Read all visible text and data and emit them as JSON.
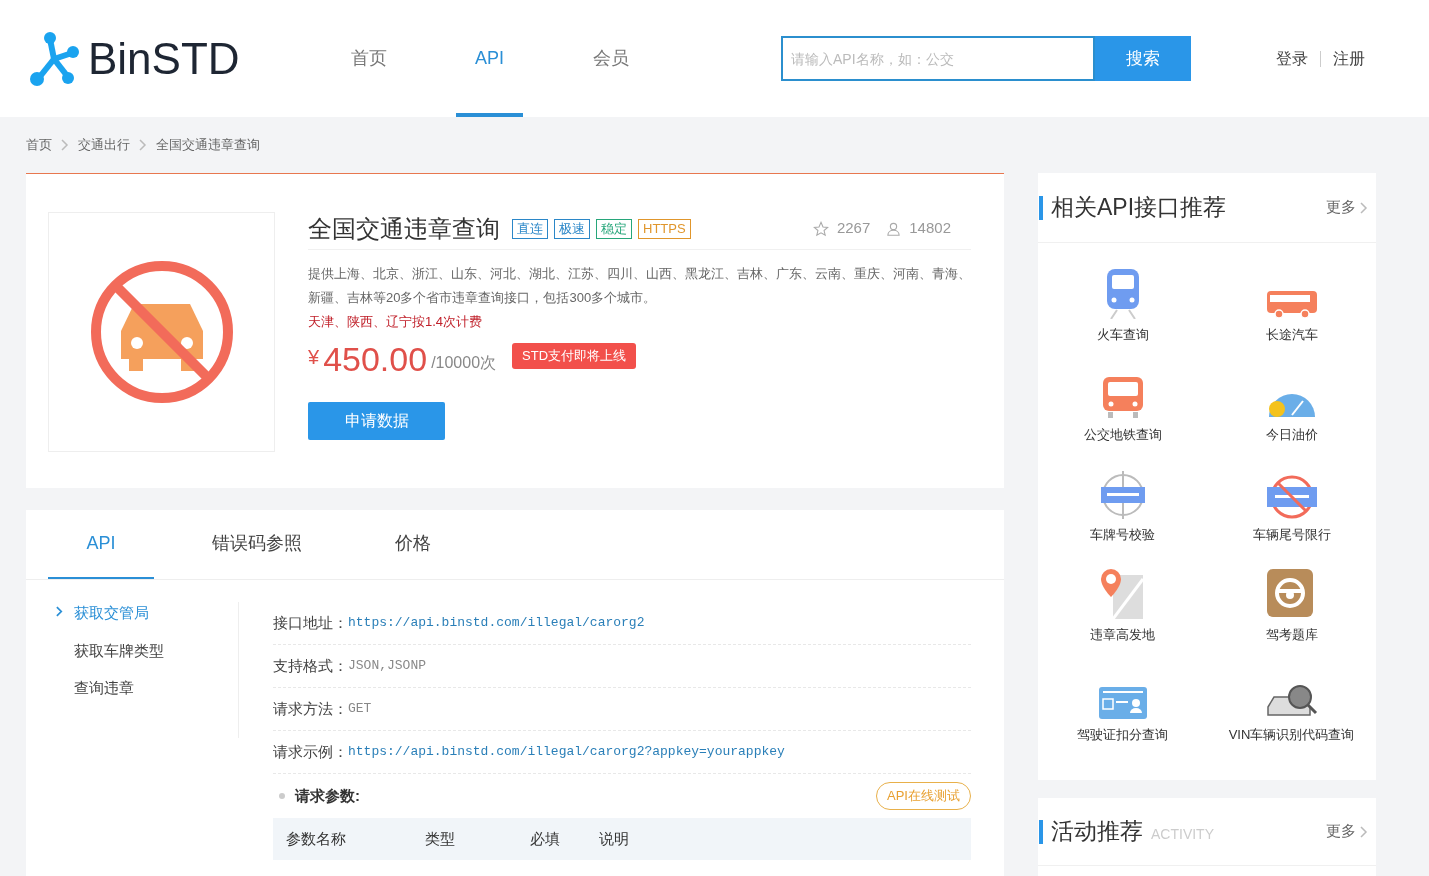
{
  "header": {
    "logo": "BinSTD",
    "nav": [
      {
        "label": "首页",
        "selected": false
      },
      {
        "label": "API",
        "selected": true
      },
      {
        "label": "会员",
        "selected": false
      }
    ],
    "search": {
      "placeholder": "请输入API名称，如：公交",
      "button": "搜索"
    },
    "auth": [
      "登录",
      "注册"
    ]
  },
  "breadcrumb": [
    "首页",
    "交通出行",
    "全国交通违章查询"
  ],
  "product": {
    "title": "全国交通违章查询",
    "tags": [
      {
        "label": "直连",
        "color": "#2b87c8"
      },
      {
        "label": "极速",
        "color": "#2b87c8"
      },
      {
        "label": "稳定",
        "color": "#27a67a"
      },
      {
        "label": "HTTPS",
        "color": "#e0962c"
      }
    ],
    "favorites": "2267",
    "users": "14802",
    "description": "提供上海、北京、浙江、山东、河北、湖北、江苏、四川、山西、黑龙江、吉林、广东、云南、重庆、河南、青海、新疆、吉林等20多个省市违章查询接口，包括300多个城市。",
    "note": "天津、陕西、辽宁按1.4次计费",
    "currency": "¥",
    "price": "450.00",
    "unit": "/10000次",
    "promo": "STD支付即将上线",
    "apply": "申请数据"
  },
  "tabs": [
    {
      "label": "API",
      "selected": true
    },
    {
      "label": "错误码参照",
      "selected": false
    },
    {
      "label": "价格",
      "selected": false
    }
  ],
  "methods": [
    {
      "label": "获取交管局",
      "selected": true
    },
    {
      "label": "获取车牌类型",
      "selected": false
    },
    {
      "label": "查询违章",
      "selected": false
    }
  ],
  "details": [
    {
      "label": "接口地址：",
      "value": "https://api.binstd.com/illegal/carorg2",
      "kind": "link"
    },
    {
      "label": "支持格式：",
      "value": "JSON,JSONP",
      "kind": "plain"
    },
    {
      "label": "请求方法：",
      "value": "GET",
      "kind": "plain"
    },
    {
      "label": "请求示例：",
      "value": "https://api.binstd.com/illegal/carorg2?appkey=yourappkey",
      "kind": "link"
    }
  ],
  "params": {
    "title": "请求参数:",
    "test_button": "API在线测试",
    "columns": [
      "参数名称",
      "类型",
      "必填",
      "说明"
    ]
  },
  "related": {
    "title": "相关API接口推荐",
    "more": "更多",
    "items": [
      {
        "label": "火车查询",
        "kind": "train"
      },
      {
        "label": "长途汽车",
        "kind": "coach"
      },
      {
        "label": "公交地铁查询",
        "kind": "bus"
      },
      {
        "label": "今日油价",
        "kind": "gauge"
      },
      {
        "label": "车牌号校验",
        "kind": "plate"
      },
      {
        "label": "车辆尾号限行",
        "kind": "restrict"
      },
      {
        "label": "违章高发地",
        "kind": "map"
      },
      {
        "label": "驾考题库",
        "kind": "wheel"
      },
      {
        "label": "驾驶证扣分查询",
        "kind": "card"
      },
      {
        "label": "VIN车辆识别代码查询",
        "kind": "vin"
      }
    ]
  },
  "activity": {
    "title": "活动推荐",
    "subtitle": "ACTIVITY",
    "more": "更多"
  }
}
